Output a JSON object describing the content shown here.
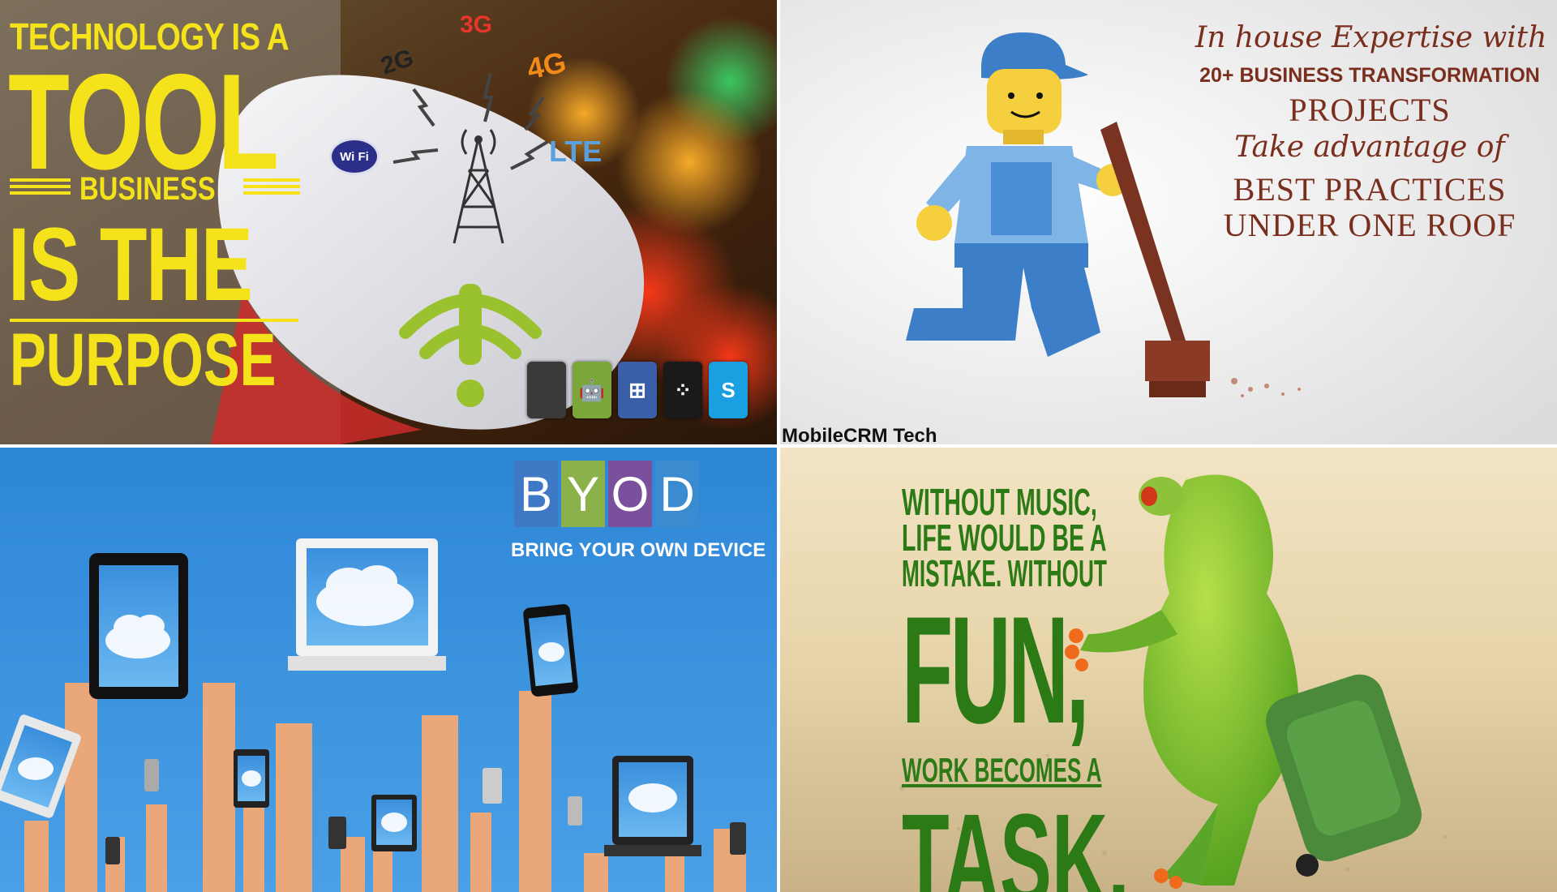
{
  "panel1": {
    "line1": "TECHNOLOGY IS A",
    "line2": "TOOL",
    "line3": "BUSINESS",
    "line4": "IS THE",
    "line5": "PURPOSE",
    "network_labels": {
      "g2": "2G",
      "g3": "3G",
      "g4": "4G",
      "lte": "LTE",
      "wifi": "Wi Fi"
    },
    "os_icons": [
      {
        "name": "apple-icon",
        "glyph": "",
        "color": "#3a3a3a"
      },
      {
        "name": "android-icon",
        "glyph": "🤖",
        "color": "#7aa63a"
      },
      {
        "name": "windows-icon",
        "glyph": "⊞",
        "color": "#3a5ea8"
      },
      {
        "name": "blackberry-icon",
        "glyph": "⁘",
        "color": "#1a1a1a"
      },
      {
        "name": "skype-icon",
        "glyph": "S",
        "color": "#1aa0e0"
      }
    ],
    "text_color": "#f4e21a"
  },
  "panel2": {
    "line1": "In house Expertise with",
    "line2": "20+ BUSINESS TRANSFORMATION",
    "line3": "PROJECTS",
    "line4": "Take advantage of",
    "line5": "BEST PRACTICES",
    "line6": "UNDER ONE ROOF",
    "brand": "MobileCRM Tech",
    "text_color": "#7a2e1d"
  },
  "panel3": {
    "letters": [
      "B",
      "Y",
      "O",
      "D"
    ],
    "subtitle": "BRING YOUR OWN DEVICE",
    "box_colors": [
      "#3f79c6",
      "#8bb24a",
      "#7a4f9c",
      "#3a8bd0"
    ]
  },
  "panel4": {
    "line1": "WITHOUT MUSIC,",
    "line2": "LIFE WOULD BE A",
    "line3": "MISTAKE. WITHOUT",
    "line4": "FUN,",
    "line5": "WORK BECOMES A",
    "line6": "TASK.",
    "text_color": "#2b7a16"
  }
}
